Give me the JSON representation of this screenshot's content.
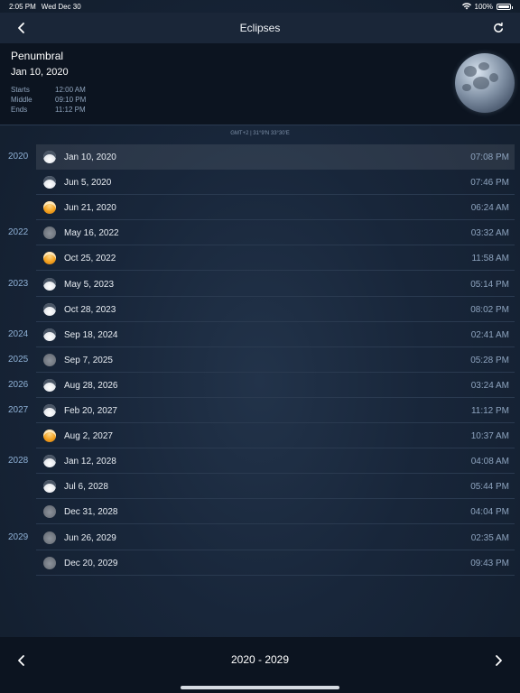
{
  "status": {
    "time": "2:05 PM",
    "date": "Wed Dec 30",
    "battery": "100%"
  },
  "nav": {
    "title": "Eclipses",
    "back_icon": "chevron-left-icon",
    "refresh_icon": "refresh-icon"
  },
  "selected": {
    "type": "Penumbral",
    "date": "Jan 10, 2020",
    "starts_label": "Starts",
    "starts": "12:00 AM",
    "middle_label": "Middle",
    "middle": "09:10 PM",
    "ends_label": "Ends",
    "ends": "11:12 PM"
  },
  "location": "GMT+2 | 31°9'N 33°30'E",
  "eclipses": [
    {
      "year": "2020",
      "date": "Jan 10, 2020",
      "time": "07:08 PM",
      "kind": "penumbral"
    },
    {
      "year": "",
      "date": "Jun 5, 2020",
      "time": "07:46 PM",
      "kind": "penumbral"
    },
    {
      "year": "",
      "date": "Jun 21, 2020",
      "time": "06:24 AM",
      "kind": "total"
    },
    {
      "year": "2022",
      "date": "May 16, 2022",
      "time": "03:32 AM",
      "kind": "partial"
    },
    {
      "year": "",
      "date": "Oct 25, 2022",
      "time": "11:58 AM",
      "kind": "total"
    },
    {
      "year": "2023",
      "date": "May 5, 2023",
      "time": "05:14 PM",
      "kind": "penumbral"
    },
    {
      "year": "",
      "date": "Oct 28, 2023",
      "time": "08:02 PM",
      "kind": "penumbral"
    },
    {
      "year": "2024",
      "date": "Sep 18, 2024",
      "time": "02:41 AM",
      "kind": "penumbral"
    },
    {
      "year": "2025",
      "date": "Sep 7, 2025",
      "time": "05:28 PM",
      "kind": "partial"
    },
    {
      "year": "2026",
      "date": "Aug 28, 2026",
      "time": "03:24 AM",
      "kind": "penumbral"
    },
    {
      "year": "2027",
      "date": "Feb 20, 2027",
      "time": "11:12 PM",
      "kind": "penumbral"
    },
    {
      "year": "",
      "date": "Aug 2, 2027",
      "time": "10:37 AM",
      "kind": "total"
    },
    {
      "year": "2028",
      "date": "Jan 12, 2028",
      "time": "04:08 AM",
      "kind": "penumbral"
    },
    {
      "year": "",
      "date": "Jul 6, 2028",
      "time": "05:44 PM",
      "kind": "penumbral"
    },
    {
      "year": "",
      "date": "Dec 31, 2028",
      "time": "04:04 PM",
      "kind": "partial"
    },
    {
      "year": "2029",
      "date": "Jun 26, 2029",
      "time": "02:35 AM",
      "kind": "partial"
    },
    {
      "year": "",
      "date": "Dec 20, 2029",
      "time": "09:43 PM",
      "kind": "partial"
    }
  ],
  "footer": {
    "range": "2020 - 2029",
    "prev_icon": "chevron-left-icon",
    "next_icon": "chevron-right-icon"
  },
  "colors": {
    "accent": "#8fb1d6",
    "background": "#18263a",
    "total_eclipse": "#f4a321"
  }
}
